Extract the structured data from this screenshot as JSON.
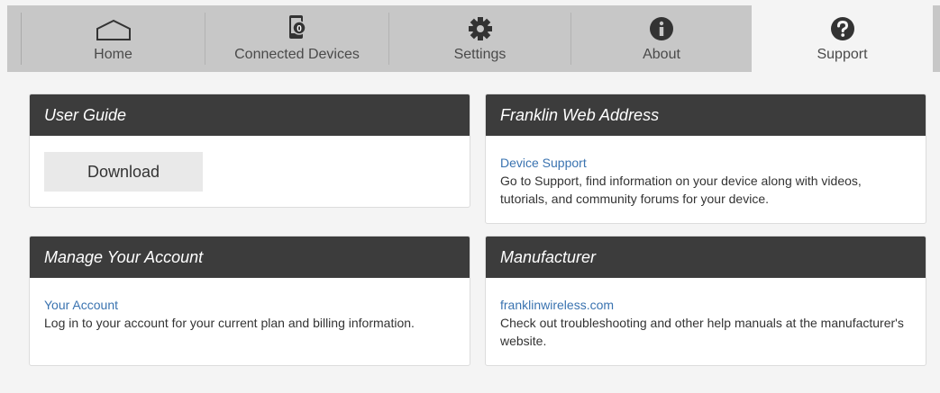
{
  "nav": {
    "items": [
      {
        "label": "Home",
        "icon": "home-icon"
      },
      {
        "label": "Connected Devices",
        "icon": "connected-devices-icon",
        "badge": "0"
      },
      {
        "label": "Settings",
        "icon": "gear-icon"
      },
      {
        "label": "About",
        "icon": "info-icon"
      },
      {
        "label": "Support",
        "icon": "question-icon",
        "active": true
      }
    ]
  },
  "cards": {
    "user_guide": {
      "title": "User Guide",
      "button": "Download"
    },
    "web_address": {
      "title": "Franklin Web Address",
      "link": "Device Support",
      "text": "Go to Support, find information on your device along with videos, tutorials, and community forums for your device."
    },
    "account": {
      "title": "Manage Your Account",
      "link": "Your Account",
      "text": "Log in to your account for your current plan and billing information."
    },
    "manufacturer": {
      "title": "Manufacturer",
      "link": "franklinwireless.com",
      "text": "Check out troubleshooting and other help manuals at the manufacturer's website."
    }
  },
  "colors": {
    "nav_bg": "#c7c7c7",
    "header_bg": "#3c3c3c",
    "link": "#3a73b0",
    "page_bg": "#f4f4f4"
  }
}
